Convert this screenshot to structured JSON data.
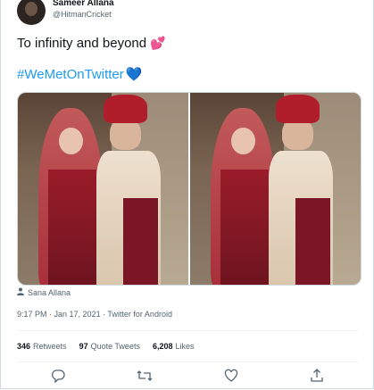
{
  "author": {
    "name": "Sameer Allana",
    "handle": "@HitmanCricket"
  },
  "tweet": {
    "text": "To infinity and beyond",
    "emoji": "💕",
    "hashtag": "#WeMetOnTwitter",
    "hashtag_emoji": "💙"
  },
  "media": {
    "tag": "Sana Allana"
  },
  "meta": {
    "time": "9:17 PM",
    "separator": " · ",
    "date": "Jan 17, 2021",
    "source": "Twitter for Android"
  },
  "stats": {
    "retweets_count": "346",
    "retweets_label": "Retweets",
    "quotes_count": "97",
    "quotes_label": "Quote Tweets",
    "likes_count": "6,208",
    "likes_label": "Likes"
  },
  "icons": [
    "reply-icon",
    "retweet-icon",
    "like-icon",
    "share-icon",
    "person-icon"
  ]
}
